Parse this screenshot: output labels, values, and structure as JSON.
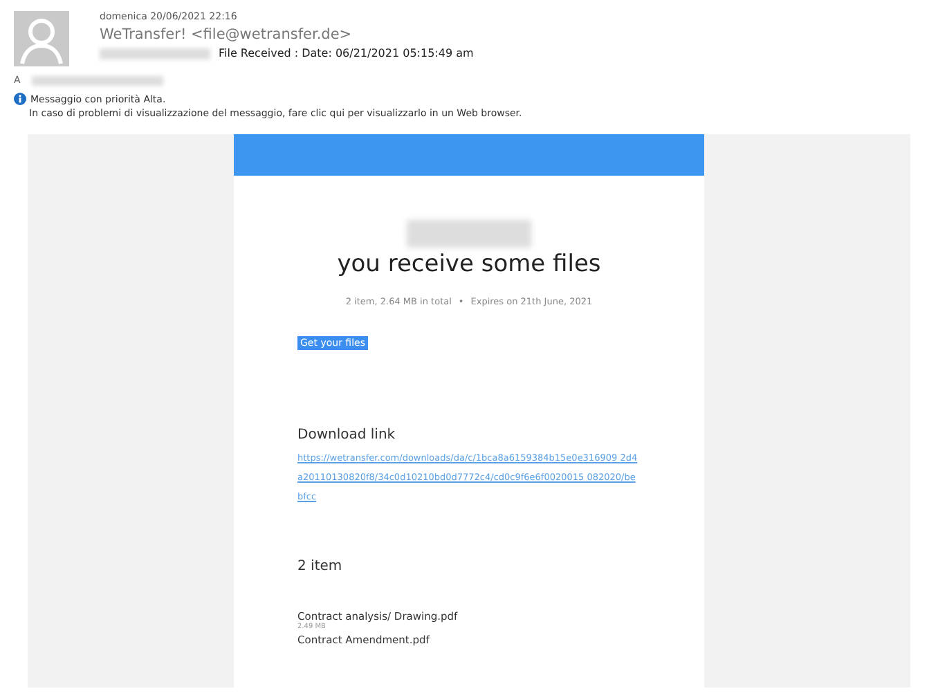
{
  "header": {
    "date": "domenica 20/06/2021 22:16",
    "sender": "WeTransfer! <file@wetransfer.de>",
    "subject": "File Received : Date: 06/21/2021 05:15:49 am",
    "to_label": "A",
    "priority": "Messaggio con priorità Alta.",
    "view_hint": "In caso di problemi di visualizzazione del messaggio, fare clic qui per visualizzarlo in un Web browser."
  },
  "email": {
    "title": "you receive some files",
    "summary": "2 item, 2.64 MB in total",
    "expires": "Expires on 21th June, 2021",
    "separator": "•",
    "button": "Get your files",
    "download_heading": "Download link",
    "download_url": "https://wetransfer.com/downloads/da/c/1bca8a6159384b15e0e316909 2d4a20110130820f8/34c0d10210bd0d7772c4/cd0c9f6e6f0020015 082020/bebfcc",
    "items_heading": "2 item",
    "files": [
      {
        "name": "Contract analysis/ Drawing.pdf",
        "size": "2.49 MB"
      },
      {
        "name": "Contract Amendment.pdf"
      }
    ]
  }
}
